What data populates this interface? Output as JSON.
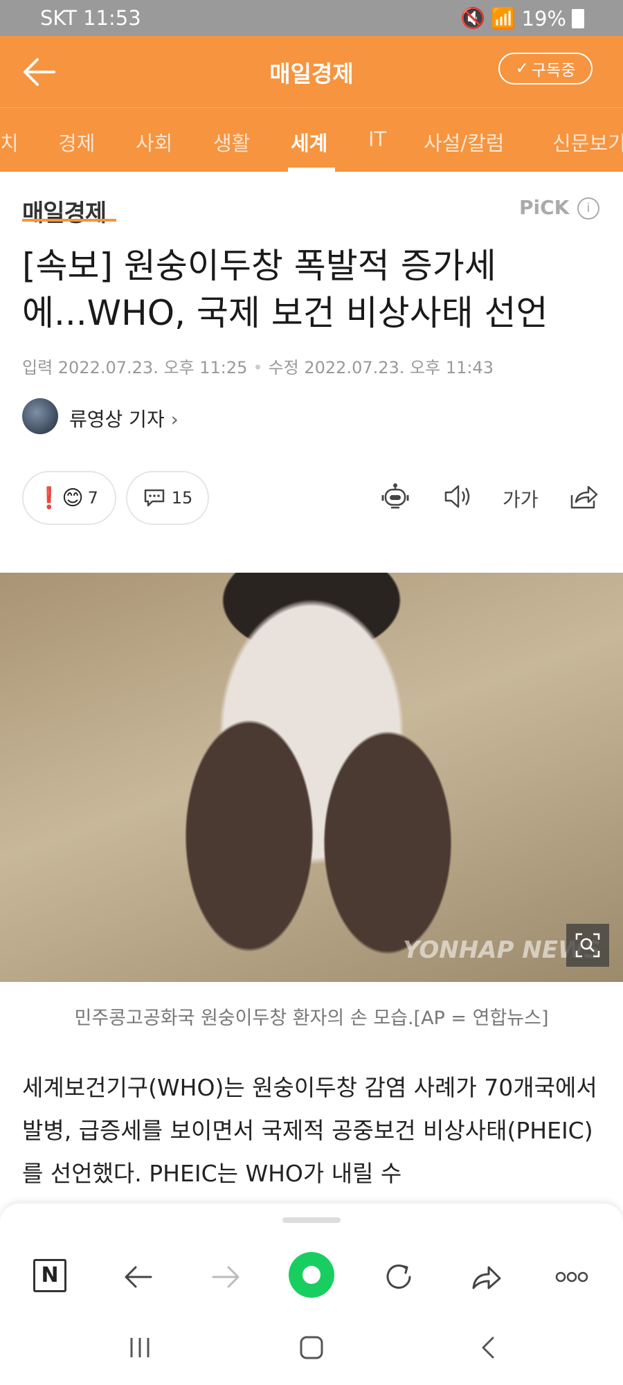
{
  "status": {
    "carrier_time": "SKT 11:53",
    "battery": "19%"
  },
  "header": {
    "title": "매일경제",
    "subscribe_label": "구독중"
  },
  "tabs": [
    "치",
    "경제",
    "사회",
    "생활",
    "세계",
    "IT",
    "사설/칼럼",
    "신문보기"
  ],
  "active_tab": "세계",
  "article": {
    "brand": "매일경제",
    "pick_label": "PiCK",
    "headline_line1": "[속보] 원숭이두창 폭발적 증가세",
    "headline_line2": "에...WHO, 국제 보건 비상사태 선언",
    "input_date": "입력 2022.07.23. 오후 11:25",
    "edit_date": "수정 2022.07.23. 오후 11:43",
    "reporter": "류영상 기자",
    "reaction_count": "7",
    "comment_count": "15",
    "fontsize_label": "가가",
    "photo_watermark": "YONHAP NEWS",
    "caption": "민주콩고공화국 원숭이두창 환자의 손 모습.[AP = 연합뉴스]",
    "body": "세계보건기구(WHO)는 원숭이두창 감염 사례가 70개국에서 발병, 급증세를 보이면서 국제적 공중보건 비상사태(PHEIC)를 선언했다. PHEIC는 WHO가 내릴 수"
  },
  "bottom_nav": {
    "n_label": "N"
  }
}
